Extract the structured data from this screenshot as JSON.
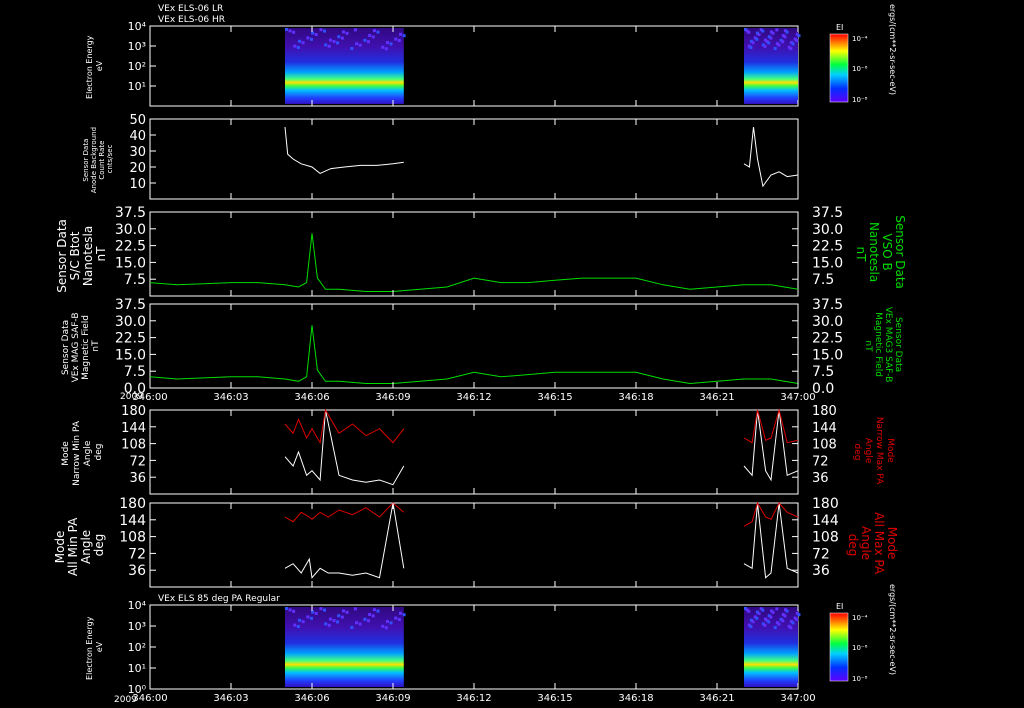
{
  "header": {
    "line1": "VEx ELS-06 LR",
    "line2": "VEx ELS-06 HR",
    "panel7_title": "VEx ELS 85 deg PA Regular"
  },
  "time_axis": {
    "year_label": "2009",
    "ticks": [
      "346:00",
      "346:03",
      "346:06",
      "346:09",
      "346:12",
      "346:15",
      "346:18",
      "346:21",
      "347:00"
    ],
    "range_minutes": [
      0,
      24
    ]
  },
  "colors": {
    "background": "#000000",
    "axis": "#ffffff",
    "green_trace": "#00dd00",
    "red_trace": "#dd0000",
    "white_trace": "#ffffff"
  },
  "chart_data": [
    {
      "type": "heatmap",
      "name": "spec1",
      "ylabel": [
        "Electron Energy",
        "eV"
      ],
      "scale": "log",
      "ylim": [
        1,
        10000
      ],
      "yticks": [
        "10⁴",
        "10³",
        "10²",
        "10¹"
      ],
      "data_intervals_minutes": [
        [
          5.0,
          9.4
        ],
        [
          22.0,
          24.0
        ]
      ],
      "colorbar": {
        "label": "EI",
        "ticks": [
          "10⁻⁴",
          "10⁻⁶",
          "10⁻⁸"
        ],
        "unit": "ergs/(cm**2-sr-sec-eV)"
      }
    },
    {
      "type": "line",
      "name": "background",
      "ylabel": [
        "Sensor Data",
        "Anode Background",
        "Count Rate",
        "cnts/sec"
      ],
      "ylim": [
        0,
        50
      ],
      "yticks": [
        10,
        20,
        30,
        40,
        50
      ],
      "series": [
        {
          "color": "white",
          "segments": [
            {
              "t": [
                5.0,
                5.1,
                5.3,
                5.6,
                6.0,
                6.3,
                6.7,
                7.2,
                7.8,
                8.4,
                9.0,
                9.4
              ],
              "y": [
                45,
                28,
                25,
                22,
                20,
                16,
                19,
                20,
                21,
                21,
                22,
                23
              ]
            },
            {
              "t": [
                22.0,
                22.2,
                22.35,
                22.5,
                22.7,
                23.0,
                23.3,
                23.6,
                24.0
              ],
              "y": [
                22,
                20,
                45,
                25,
                8,
                15,
                17,
                14,
                15
              ]
            }
          ]
        }
      ]
    },
    {
      "type": "line",
      "name": "bmag_sc",
      "ylabel": [
        "Sensor Data",
        "S/C Btot",
        "Nanotesla",
        "nT"
      ],
      "ylabel_right": [
        "Sensor Data",
        "VSO B",
        "Nanotesla",
        "nT"
      ],
      "ylim": [
        0,
        37.5
      ],
      "yticks": [
        7.5,
        15.0,
        22.5,
        30.0,
        37.5
      ],
      "series": [
        {
          "color": "green",
          "t": [
            0,
            1,
            2,
            3,
            4,
            5,
            5.5,
            5.8,
            6.0,
            6.2,
            6.5,
            7,
            8,
            9,
            10,
            11,
            12,
            13,
            14,
            15,
            16,
            17,
            18,
            19,
            20,
            21,
            22,
            23,
            24
          ],
          "y": [
            6,
            5,
            5.5,
            6,
            6,
            5,
            4,
            6,
            28,
            8,
            3,
            3,
            2,
            2,
            3,
            4,
            8,
            6,
            6,
            7,
            8,
            8,
            8,
            5,
            3,
            4,
            5,
            5,
            3
          ]
        }
      ]
    },
    {
      "type": "line",
      "name": "bmag_saf",
      "ylabel": [
        "Sensor Data",
        "VEx MAG SAF-B",
        "Magnetic Field",
        "nT"
      ],
      "ylabel_right": [
        "Sensor Data",
        "VEx MAG3 SAF-B",
        "Magnetic Field",
        "nT"
      ],
      "ylim": [
        0,
        37.5
      ],
      "yticks": [
        0.0,
        7.5,
        15.0,
        22.5,
        30.0,
        37.5
      ],
      "series": [
        {
          "color": "green",
          "t": [
            0,
            1,
            2,
            3,
            4,
            5,
            5.5,
            5.8,
            6.0,
            6.2,
            6.5,
            7,
            8,
            9,
            10,
            11,
            12,
            13,
            14,
            15,
            16,
            17,
            18,
            19,
            20,
            21,
            22,
            23,
            24
          ],
          "y": [
            5,
            4,
            4.5,
            5,
            5,
            4,
            3,
            5,
            28,
            8,
            3,
            3,
            2,
            2,
            3,
            4,
            7,
            5,
            6,
            7,
            7,
            7,
            7,
            4,
            2,
            3,
            4,
            4,
            2
          ]
        }
      ]
    },
    {
      "type": "line",
      "name": "pa_narrow",
      "ylabel": [
        "Mode",
        "Narrow Min PA",
        "Angle",
        "deg"
      ],
      "ylabel_right": [
        "Mode",
        "Narrow Max PA",
        "Angle",
        "deg"
      ],
      "ylim": [
        0,
        180
      ],
      "yticks": [
        36,
        72,
        108,
        144,
        180
      ],
      "series": [
        {
          "color": "white",
          "segments": [
            {
              "t": [
                5.0,
                5.3,
                5.5,
                5.8,
                6.0,
                6.3,
                6.5,
                7.0,
                7.5,
                8.0,
                8.5,
                9.0,
                9.4
              ],
              "y": [
                80,
                60,
                90,
                40,
                50,
                30,
                180,
                40,
                30,
                25,
                30,
                20,
                60
              ]
            },
            {
              "t": [
                22.0,
                22.3,
                22.5,
                22.8,
                23.0,
                23.3,
                23.6,
                24.0
              ],
              "y": [
                60,
                40,
                180,
                50,
                30,
                180,
                40,
                50
              ]
            }
          ]
        },
        {
          "color": "red",
          "segments": [
            {
              "t": [
                5.0,
                5.3,
                5.5,
                5.8,
                6.0,
                6.3,
                6.5,
                7.0,
                7.5,
                8.0,
                8.5,
                9.0,
                9.4
              ],
              "y": [
                150,
                130,
                160,
                120,
                140,
                110,
                180,
                130,
                150,
                125,
                140,
                110,
                140
              ]
            },
            {
              "t": [
                22.0,
                22.3,
                22.5,
                22.8,
                23.0,
                23.3,
                23.6,
                24.0
              ],
              "y": [
                120,
                110,
                180,
                115,
                120,
                180,
                110,
                115
              ]
            }
          ]
        }
      ]
    },
    {
      "type": "line",
      "name": "pa_all",
      "ylabel": [
        "Mode",
        "All Min PA",
        "Angle",
        "deg"
      ],
      "ylabel_right": [
        "Mode",
        "All Max PA",
        "Angle",
        "deg"
      ],
      "ylim": [
        0,
        180
      ],
      "yticks": [
        36,
        72,
        108,
        144,
        180
      ],
      "series": [
        {
          "color": "white",
          "segments": [
            {
              "t": [
                5.0,
                5.3,
                5.6,
                5.9,
                6.0,
                6.3,
                6.6,
                7.0,
                7.5,
                8.0,
                8.5,
                9.0,
                9.4
              ],
              "y": [
                40,
                50,
                30,
                60,
                20,
                40,
                30,
                30,
                25,
                30,
                20,
                180,
                40
              ]
            },
            {
              "t": [
                22.0,
                22.3,
                22.5,
                22.8,
                23.0,
                23.3,
                23.6,
                24.0
              ],
              "y": [
                50,
                40,
                180,
                20,
                30,
                180,
                40,
                30
              ]
            }
          ]
        },
        {
          "color": "red",
          "segments": [
            {
              "t": [
                5.0,
                5.3,
                5.6,
                5.9,
                6.0,
                6.3,
                6.6,
                7.0,
                7.5,
                8.0,
                8.5,
                9.0,
                9.4
              ],
              "y": [
                150,
                140,
                160,
                150,
                145,
                160,
                150,
                165,
                155,
                170,
                150,
                180,
                160
              ]
            },
            {
              "t": [
                22.0,
                22.3,
                22.5,
                22.8,
                23.0,
                23.3,
                23.6,
                24.0
              ],
              "y": [
                130,
                140,
                180,
                150,
                145,
                180,
                160,
                150
              ]
            }
          ]
        }
      ]
    },
    {
      "type": "heatmap",
      "name": "spec2",
      "ylabel": [
        "Electron Energy",
        "eV"
      ],
      "scale": "log",
      "ylim": [
        1,
        10000
      ],
      "yticks": [
        "10⁴",
        "10³",
        "10²",
        "10¹",
        "10⁰"
      ],
      "data_intervals_minutes": [
        [
          5.0,
          9.4
        ],
        [
          22.0,
          24.0
        ]
      ],
      "colorbar": {
        "label": "EI",
        "ticks": [
          "10⁻⁴",
          "10⁻⁶",
          "10⁻⁸"
        ],
        "unit": "ergs/(cm**2-sr-sec-eV)"
      }
    }
  ]
}
